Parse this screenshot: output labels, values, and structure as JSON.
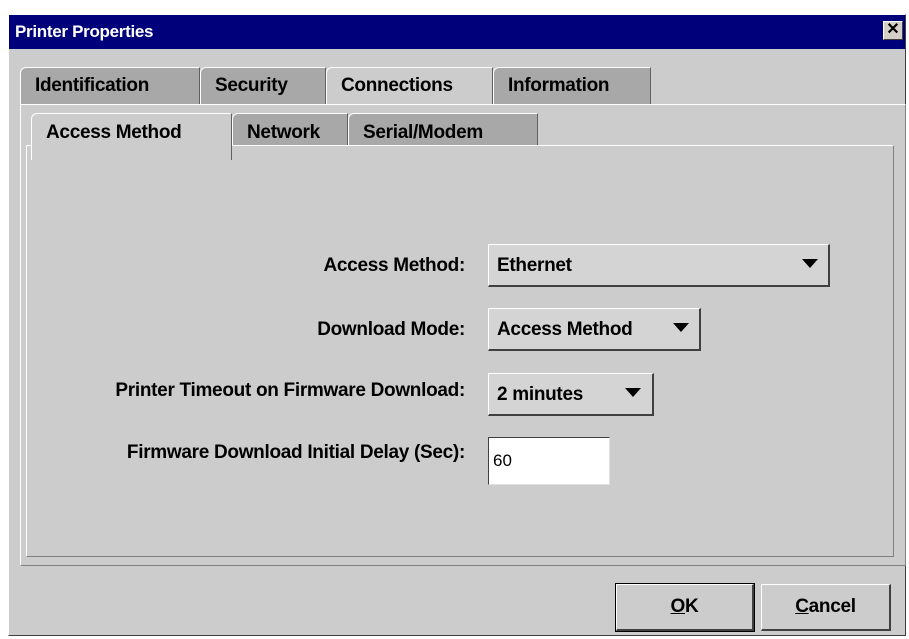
{
  "window": {
    "title": "Printer Properties",
    "close_glyph": "✕"
  },
  "tabs": [
    {
      "label": "Identification",
      "selected": false
    },
    {
      "label": "Security",
      "selected": false
    },
    {
      "label": "Connections",
      "selected": true
    },
    {
      "label": "Information",
      "selected": false
    }
  ],
  "subtabs": [
    {
      "label": "Access Method",
      "selected": true
    },
    {
      "label": "Network",
      "selected": false
    },
    {
      "label": "Serial/Modem",
      "selected": false
    }
  ],
  "form": {
    "access_method": {
      "label": "Access Method:",
      "value": "Ethernet"
    },
    "download_mode": {
      "label": "Download Mode:",
      "value": "Access Method"
    },
    "printer_timeout": {
      "label": "Printer Timeout on Firmware Download:",
      "value": "2 minutes"
    },
    "initial_delay": {
      "label": "Firmware Download Initial Delay (Sec):",
      "value": "60"
    }
  },
  "buttons": {
    "ok": {
      "mnemonic": "O",
      "rest": "K"
    },
    "cancel": {
      "mnemonic": "C",
      "rest": "ancel"
    }
  },
  "colors": {
    "titlebar": "#00007a",
    "window_bg": "#cccccc",
    "inactive_tab": "#a8a8a8"
  }
}
